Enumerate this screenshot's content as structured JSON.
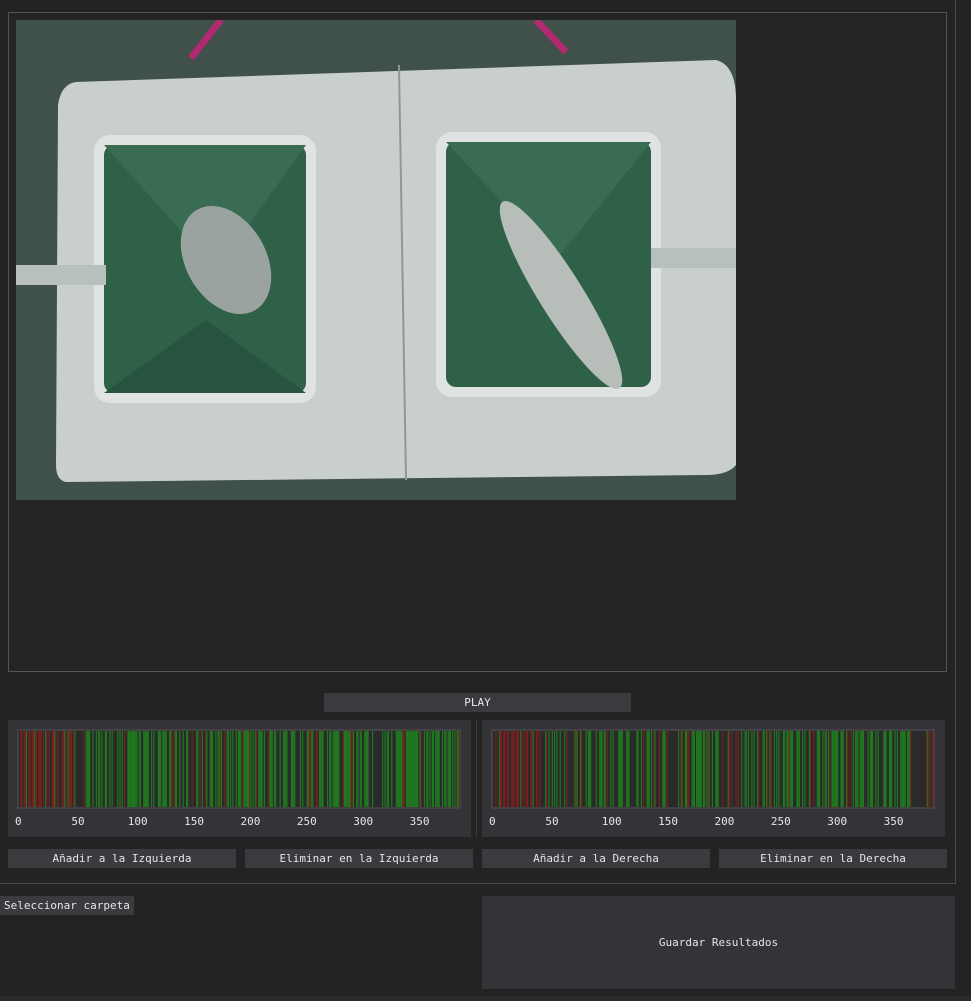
{
  "play_label": "PLAY",
  "left_timeline": {
    "ticks": [
      "0",
      "50",
      "100",
      "150",
      "200",
      "250",
      "300",
      "350"
    ],
    "frames": 392,
    "green": "#1f7a1f",
    "red": "#7a1f1f",
    "background": "#2a2a2a"
  },
  "right_timeline": {
    "ticks": [
      "0",
      "50",
      "100",
      "150",
      "200",
      "250",
      "300",
      "350"
    ],
    "frames": 392,
    "green": "#1f7a1f",
    "red": "#7a1f1f",
    "background": "#2a2a2a"
  },
  "buttons": {
    "add_left": "Añadir a la Izquierda",
    "remove_left": "Eliminar en la Izquierda",
    "add_right": "Añadir a la Derecha",
    "remove_right": "Eliminar en la Derecha",
    "select_folder": "Seleccionar carpeta",
    "save_results": "Guardar Resultados"
  }
}
